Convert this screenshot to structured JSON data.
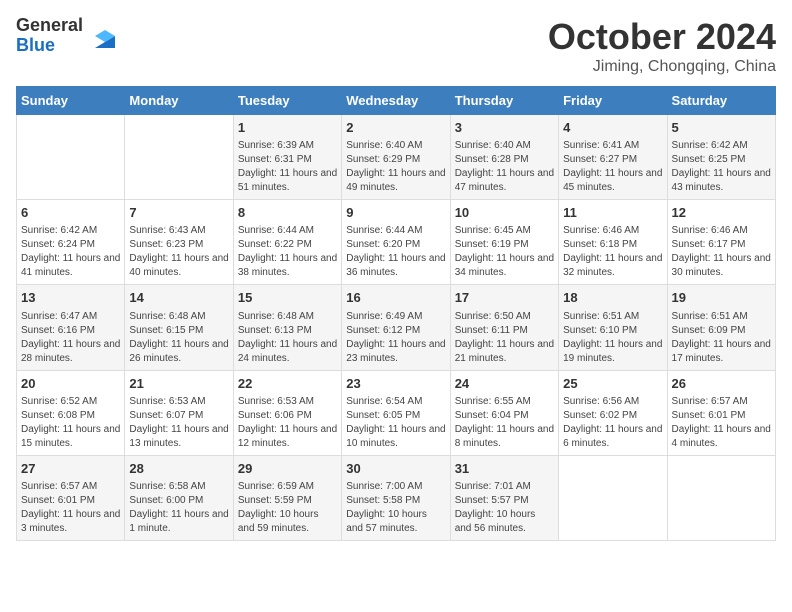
{
  "header": {
    "logo_line1": "General",
    "logo_line2": "Blue",
    "month_title": "October 2024",
    "location": "Jiming, Chongqing, China"
  },
  "weekdays": [
    "Sunday",
    "Monday",
    "Tuesday",
    "Wednesday",
    "Thursday",
    "Friday",
    "Saturday"
  ],
  "weeks": [
    [
      {
        "day": "",
        "sunrise": "",
        "sunset": "",
        "daylight": ""
      },
      {
        "day": "",
        "sunrise": "",
        "sunset": "",
        "daylight": ""
      },
      {
        "day": "1",
        "sunrise": "Sunrise: 6:39 AM",
        "sunset": "Sunset: 6:31 PM",
        "daylight": "Daylight: 11 hours and 51 minutes."
      },
      {
        "day": "2",
        "sunrise": "Sunrise: 6:40 AM",
        "sunset": "Sunset: 6:29 PM",
        "daylight": "Daylight: 11 hours and 49 minutes."
      },
      {
        "day": "3",
        "sunrise": "Sunrise: 6:40 AM",
        "sunset": "Sunset: 6:28 PM",
        "daylight": "Daylight: 11 hours and 47 minutes."
      },
      {
        "day": "4",
        "sunrise": "Sunrise: 6:41 AM",
        "sunset": "Sunset: 6:27 PM",
        "daylight": "Daylight: 11 hours and 45 minutes."
      },
      {
        "day": "5",
        "sunrise": "Sunrise: 6:42 AM",
        "sunset": "Sunset: 6:25 PM",
        "daylight": "Daylight: 11 hours and 43 minutes."
      }
    ],
    [
      {
        "day": "6",
        "sunrise": "Sunrise: 6:42 AM",
        "sunset": "Sunset: 6:24 PM",
        "daylight": "Daylight: 11 hours and 41 minutes."
      },
      {
        "day": "7",
        "sunrise": "Sunrise: 6:43 AM",
        "sunset": "Sunset: 6:23 PM",
        "daylight": "Daylight: 11 hours and 40 minutes."
      },
      {
        "day": "8",
        "sunrise": "Sunrise: 6:44 AM",
        "sunset": "Sunset: 6:22 PM",
        "daylight": "Daylight: 11 hours and 38 minutes."
      },
      {
        "day": "9",
        "sunrise": "Sunrise: 6:44 AM",
        "sunset": "Sunset: 6:20 PM",
        "daylight": "Daylight: 11 hours and 36 minutes."
      },
      {
        "day": "10",
        "sunrise": "Sunrise: 6:45 AM",
        "sunset": "Sunset: 6:19 PM",
        "daylight": "Daylight: 11 hours and 34 minutes."
      },
      {
        "day": "11",
        "sunrise": "Sunrise: 6:46 AM",
        "sunset": "Sunset: 6:18 PM",
        "daylight": "Daylight: 11 hours and 32 minutes."
      },
      {
        "day": "12",
        "sunrise": "Sunrise: 6:46 AM",
        "sunset": "Sunset: 6:17 PM",
        "daylight": "Daylight: 11 hours and 30 minutes."
      }
    ],
    [
      {
        "day": "13",
        "sunrise": "Sunrise: 6:47 AM",
        "sunset": "Sunset: 6:16 PM",
        "daylight": "Daylight: 11 hours and 28 minutes."
      },
      {
        "day": "14",
        "sunrise": "Sunrise: 6:48 AM",
        "sunset": "Sunset: 6:15 PM",
        "daylight": "Daylight: 11 hours and 26 minutes."
      },
      {
        "day": "15",
        "sunrise": "Sunrise: 6:48 AM",
        "sunset": "Sunset: 6:13 PM",
        "daylight": "Daylight: 11 hours and 24 minutes."
      },
      {
        "day": "16",
        "sunrise": "Sunrise: 6:49 AM",
        "sunset": "Sunset: 6:12 PM",
        "daylight": "Daylight: 11 hours and 23 minutes."
      },
      {
        "day": "17",
        "sunrise": "Sunrise: 6:50 AM",
        "sunset": "Sunset: 6:11 PM",
        "daylight": "Daylight: 11 hours and 21 minutes."
      },
      {
        "day": "18",
        "sunrise": "Sunrise: 6:51 AM",
        "sunset": "Sunset: 6:10 PM",
        "daylight": "Daylight: 11 hours and 19 minutes."
      },
      {
        "day": "19",
        "sunrise": "Sunrise: 6:51 AM",
        "sunset": "Sunset: 6:09 PM",
        "daylight": "Daylight: 11 hours and 17 minutes."
      }
    ],
    [
      {
        "day": "20",
        "sunrise": "Sunrise: 6:52 AM",
        "sunset": "Sunset: 6:08 PM",
        "daylight": "Daylight: 11 hours and 15 minutes."
      },
      {
        "day": "21",
        "sunrise": "Sunrise: 6:53 AM",
        "sunset": "Sunset: 6:07 PM",
        "daylight": "Daylight: 11 hours and 13 minutes."
      },
      {
        "day": "22",
        "sunrise": "Sunrise: 6:53 AM",
        "sunset": "Sunset: 6:06 PM",
        "daylight": "Daylight: 11 hours and 12 minutes."
      },
      {
        "day": "23",
        "sunrise": "Sunrise: 6:54 AM",
        "sunset": "Sunset: 6:05 PM",
        "daylight": "Daylight: 11 hours and 10 minutes."
      },
      {
        "day": "24",
        "sunrise": "Sunrise: 6:55 AM",
        "sunset": "Sunset: 6:04 PM",
        "daylight": "Daylight: 11 hours and 8 minutes."
      },
      {
        "day": "25",
        "sunrise": "Sunrise: 6:56 AM",
        "sunset": "Sunset: 6:02 PM",
        "daylight": "Daylight: 11 hours and 6 minutes."
      },
      {
        "day": "26",
        "sunrise": "Sunrise: 6:57 AM",
        "sunset": "Sunset: 6:01 PM",
        "daylight": "Daylight: 11 hours and 4 minutes."
      }
    ],
    [
      {
        "day": "27",
        "sunrise": "Sunrise: 6:57 AM",
        "sunset": "Sunset: 6:01 PM",
        "daylight": "Daylight: 11 hours and 3 minutes."
      },
      {
        "day": "28",
        "sunrise": "Sunrise: 6:58 AM",
        "sunset": "Sunset: 6:00 PM",
        "daylight": "Daylight: 11 hours and 1 minute."
      },
      {
        "day": "29",
        "sunrise": "Sunrise: 6:59 AM",
        "sunset": "Sunset: 5:59 PM",
        "daylight": "Daylight: 10 hours and 59 minutes."
      },
      {
        "day": "30",
        "sunrise": "Sunrise: 7:00 AM",
        "sunset": "Sunset: 5:58 PM",
        "daylight": "Daylight: 10 hours and 57 minutes."
      },
      {
        "day": "31",
        "sunrise": "Sunrise: 7:01 AM",
        "sunset": "Sunset: 5:57 PM",
        "daylight": "Daylight: 10 hours and 56 minutes."
      },
      {
        "day": "",
        "sunrise": "",
        "sunset": "",
        "daylight": ""
      },
      {
        "day": "",
        "sunrise": "",
        "sunset": "",
        "daylight": ""
      }
    ]
  ]
}
